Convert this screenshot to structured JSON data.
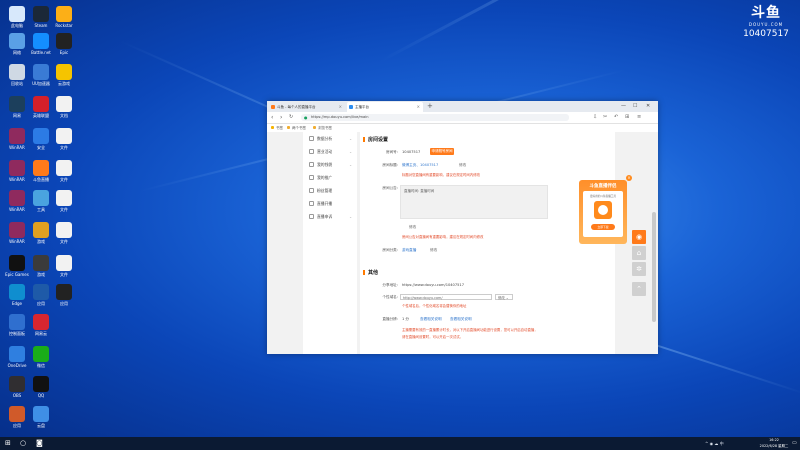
{
  "watermark": {
    "logo": "斗鱼",
    "logo_sub": "DOUYU.COM",
    "room_number": "10407517"
  },
  "desktop_icons": [
    {
      "label": "此电脑",
      "color": "#d7e8fb"
    },
    {
      "label": "Steam",
      "color": "#1b2838"
    },
    {
      "label": "Rockstar",
      "color": "#fcaf17"
    },
    {
      "label": "网络",
      "color": "#5aa0e6"
    },
    {
      "label": "Battle.net",
      "color": "#148eff"
    },
    {
      "label": "Epic",
      "color": "#222222"
    },
    {
      "label": "回收站",
      "color": "#cfd9e4"
    },
    {
      "label": "UU加速器",
      "color": "#3a7bd5"
    },
    {
      "label": "云游戏",
      "color": "#f5c400"
    },
    {
      "label": "网易",
      "color": "#1c3f5c"
    },
    {
      "label": "英雄联盟",
      "color": "#d4202a"
    },
    {
      "label": "文档",
      "color": "#f2f2f2"
    },
    {
      "label": "WinRAR",
      "color": "#8f2a5e"
    },
    {
      "label": "安全",
      "color": "#2c7be5"
    },
    {
      "label": "文件",
      "color": "#f2f2f2"
    },
    {
      "label": "WinRAR",
      "color": "#8f2a5e"
    },
    {
      "label": "斗鱼直播",
      "color": "#ff7a1a"
    },
    {
      "label": "文件",
      "color": "#f2f2f2"
    },
    {
      "label": "WinRAR",
      "color": "#8f2a5e"
    },
    {
      "label": "工具",
      "color": "#4aa3df"
    },
    {
      "label": "文件",
      "color": "#f2f2f2"
    },
    {
      "label": "WinRAR",
      "color": "#8f2a5e"
    },
    {
      "label": "游戏",
      "color": "#e0a020"
    },
    {
      "label": "文件",
      "color": "#f2f2f2"
    },
    {
      "label": "Epic Games",
      "color": "#111111"
    },
    {
      "label": "游戏",
      "color": "#3b3b3b"
    },
    {
      "label": "文件",
      "color": "#f2f2f2"
    },
    {
      "label": "Edge",
      "color": "#0f8ecf"
    },
    {
      "label": "应用",
      "color": "#1e5aa8"
    },
    {
      "label": "应用",
      "color": "#222222"
    },
    {
      "label": "控制面板",
      "color": "#2f6fcf"
    },
    {
      "label": "网易云",
      "color": "#d7262f"
    },
    {
      "label": "OneDrive",
      "color": "#2f7fe0"
    },
    {
      "label": "微信",
      "color": "#1aad19"
    },
    {
      "label": "OBS",
      "color": "#302e31"
    },
    {
      "label": "QQ",
      "color": "#111111"
    },
    {
      "label": "应用",
      "color": "#d05a2a"
    },
    {
      "label": "云盘",
      "color": "#3f8fe6"
    }
  ],
  "browser": {
    "tab1_title": "斗鱼 - 每个人的直播平台",
    "tab2_title": "主播平台",
    "new_tab": "+",
    "url": "https://mp.douyu.com/live/main",
    "bookmarks": [
      "书签",
      "两个书签",
      "浏览书签"
    ]
  },
  "sidebar": {
    "items": [
      "数据分析",
      "营业活动",
      "我的钱袋",
      "我的推广",
      "粉丝管理",
      "直播开播",
      "直播申诉"
    ]
  },
  "room_settings": {
    "title": "房间设置",
    "room_number_label": "房间号:",
    "room_number": "10407517",
    "apply_button": "申请靓号房间",
    "room_title_label": "房间标题:",
    "room_title_link": "微博主页、10407517",
    "room_title_edit": "修改",
    "room_title_note": "标题对您直播间有重要影响，建议在规定时间内修改",
    "announcement_label": "房间公告:",
    "announcement_text": "直播时间: 直播时间",
    "announcement_edit": "修改",
    "announcement_note": "房间公告对直播间有重要影响，建议在规定时间内修改",
    "category_label": "房间分类:",
    "category_link": "游戏直播",
    "category_edit": "修改"
  },
  "other": {
    "title": "其他",
    "stream_url_label": "分享地址:",
    "stream_url": "https://www.douyu.com/10407517",
    "custom_url_label": "个性域名:",
    "custom_url_value": "http://www.douyu.com/",
    "custom_url_select": "修改",
    "custom_url_note": "个性域名后，个性化域名将会替换你的地址",
    "mode_label": "直播分辨:",
    "mode_value": "1 分",
    "mode_link1": "查看相关说明",
    "mode_link2": "查看相关说明",
    "mode_note1": "主播需要有效的一直播累计时长，对以下开启直播间功能进行设置，您可以开启自动直播，",
    "mode_note2": "请在直播间设置时，可以开启一次试试。"
  },
  "promo": {
    "title": "斗鱼直播伴侣",
    "subtitle": "更好用的斗鱼直播工具",
    "button": "立即下载",
    "close": "×"
  },
  "taskbar": {
    "time": "16:22",
    "date": "2022/6/28",
    "weekday": "星期二",
    "lang": "中",
    "tray_text": "^ ◉ ☁ 中"
  }
}
